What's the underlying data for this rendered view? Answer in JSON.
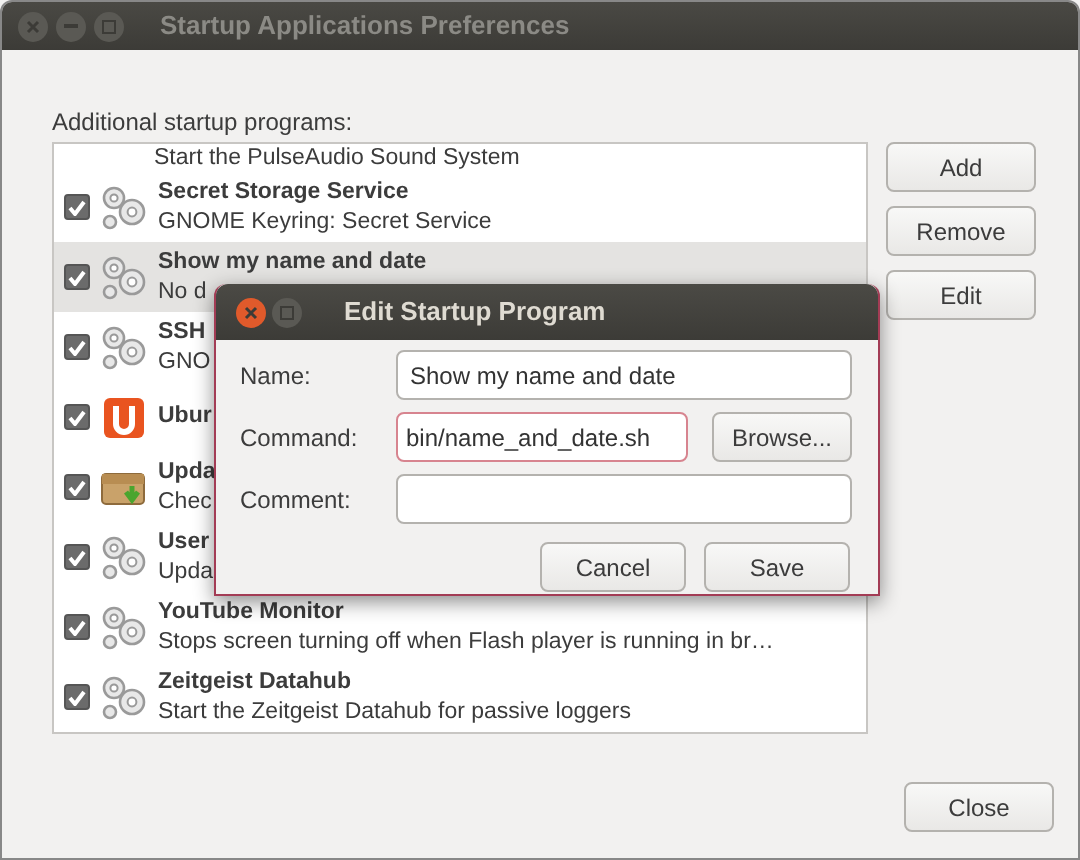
{
  "window": {
    "title": "Startup Applications Preferences"
  },
  "section_label": "Additional startup programs:",
  "programs": [
    {
      "kind": "tail",
      "description": "Start the PulseAudio Sound System",
      "selected": false
    },
    {
      "kind": "gears",
      "name": "Secret Storage Service",
      "description": "GNOME Keyring: Secret Service",
      "checked": true,
      "selected": false
    },
    {
      "kind": "gears",
      "name": "Show my name and date",
      "description": "No d",
      "checked": true,
      "selected": true
    },
    {
      "kind": "gears",
      "name": "SSH",
      "description": "GNO",
      "checked": true,
      "selected": false
    },
    {
      "kind": "ubuntu-one",
      "name": "Ubur",
      "checked": true,
      "selected": false
    },
    {
      "kind": "package",
      "name": "Upda",
      "description": "Chec",
      "checked": true,
      "selected": false
    },
    {
      "kind": "gears",
      "name": "User",
      "description": "Upda",
      "checked": true,
      "selected": false
    },
    {
      "kind": "gears",
      "name": "YouTube Monitor",
      "description": "Stops screen turning off when Flash player is running in br…",
      "checked": true,
      "selected": false
    },
    {
      "kind": "gears",
      "name": "Zeitgeist Datahub",
      "description": "Start the Zeitgeist Datahub for passive loggers",
      "checked": true,
      "selected": false
    }
  ],
  "side_buttons": [
    "Add",
    "Remove",
    "Edit"
  ],
  "close_button": "Close",
  "dialog": {
    "title": "Edit Startup Program",
    "fields": [
      {
        "label": "Name:",
        "value": "Show my name and date",
        "focused": false
      },
      {
        "label": "Command:",
        "value": "bin/name_and_date.sh",
        "focused": true,
        "browse": "Browse..."
      },
      {
        "label": "Comment:",
        "focused": false
      }
    ],
    "buttons": [
      "Cancel",
      "Save"
    ]
  }
}
